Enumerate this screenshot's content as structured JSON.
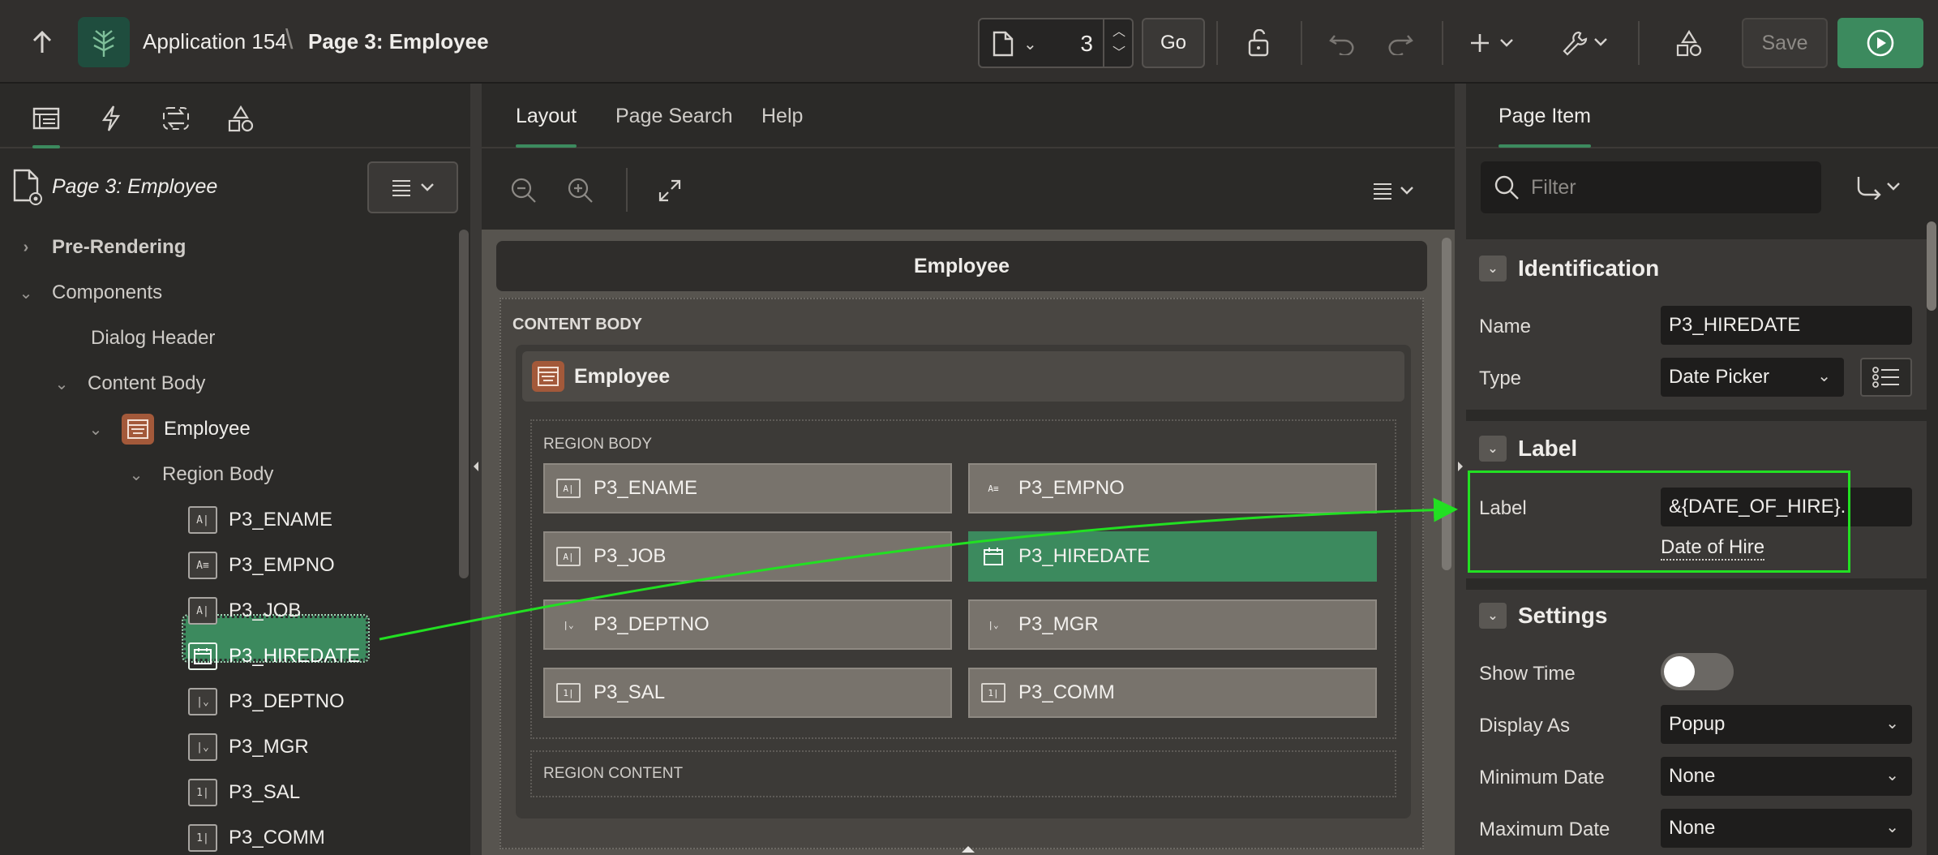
{
  "topbar": {
    "app_name": "Application 154",
    "separator": "\\",
    "page_title": "Page 3: Employee",
    "page_number": "3",
    "go_label": "Go",
    "save_label": "Save"
  },
  "left": {
    "page_root": "Page 3: Employee",
    "tree": {
      "pre_rendering": "Pre-Rendering",
      "components": "Components",
      "dialog_header": "Dialog Header",
      "content_body": "Content Body",
      "employee": "Employee",
      "region_body": "Region Body",
      "items": [
        {
          "name": "P3_ENAME",
          "icon": "text-field-icon"
        },
        {
          "name": "P3_EMPNO",
          "icon": "display-only-icon"
        },
        {
          "name": "P3_JOB",
          "icon": "text-field-icon"
        },
        {
          "name": "P3_HIREDATE",
          "icon": "calendar-icon"
        },
        {
          "name": "P3_DEPTNO",
          "icon": "select-list-icon"
        },
        {
          "name": "P3_MGR",
          "icon": "select-list-icon"
        },
        {
          "name": "P3_SAL",
          "icon": "number-field-icon"
        },
        {
          "name": "P3_COMM",
          "icon": "number-field-icon"
        }
      ]
    }
  },
  "center": {
    "tabs": [
      "Layout",
      "Page Search",
      "Help"
    ],
    "header_title": "Employee",
    "content_body_label": "CONTENT BODY",
    "region_title": "Employee",
    "region_body_label": "REGION BODY",
    "region_content_label": "REGION CONTENT",
    "items": [
      {
        "name": "P3_ENAME",
        "icon": "text-field-icon"
      },
      {
        "name": "P3_EMPNO",
        "icon": "display-only-icon"
      },
      {
        "name": "P3_JOB",
        "icon": "text-field-icon"
      },
      {
        "name": "P3_HIREDATE",
        "icon": "calendar-icon"
      },
      {
        "name": "P3_DEPTNO",
        "icon": "select-list-icon"
      },
      {
        "name": "P3_MGR",
        "icon": "select-list-icon"
      },
      {
        "name": "P3_SAL",
        "icon": "number-field-icon"
      },
      {
        "name": "P3_COMM",
        "icon": "number-field-icon"
      }
    ]
  },
  "right": {
    "tab": "Page Item",
    "filter_placeholder": "Filter",
    "identification": {
      "title": "Identification",
      "name_label": "Name",
      "name_value": "P3_HIREDATE",
      "type_label": "Type",
      "type_value": "Date Picker"
    },
    "label_section": {
      "title": "Label",
      "label_label": "Label",
      "label_value": "&{DATE_OF_HIRE}.",
      "label_preview": "Date of Hire"
    },
    "settings": {
      "title": "Settings",
      "show_time_label": "Show Time",
      "display_as_label": "Display As",
      "display_as_value": "Popup",
      "min_date_label": "Minimum Date",
      "min_date_value": "None",
      "max_date_label": "Maximum Date",
      "max_date_value": "None"
    }
  },
  "colors": {
    "accent_green": "#3c8a5e",
    "annotation_green": "#22e022",
    "region_orange": "#a3593a"
  }
}
